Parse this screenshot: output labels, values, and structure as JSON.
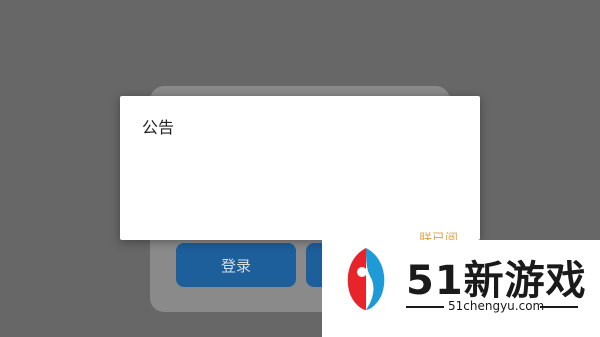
{
  "background": {
    "login": {
      "login_button": "登录"
    }
  },
  "dialog": {
    "title": "公告",
    "confirm_label": "朕已阅"
  },
  "watermark": {
    "brand": "51新游戏",
    "url": "51chengyu.com"
  },
  "colors": {
    "overlay": "#676767",
    "dialog_bg": "#ffffff",
    "accent_action": "#e0a84a",
    "login_button": "#1d5f9b"
  }
}
